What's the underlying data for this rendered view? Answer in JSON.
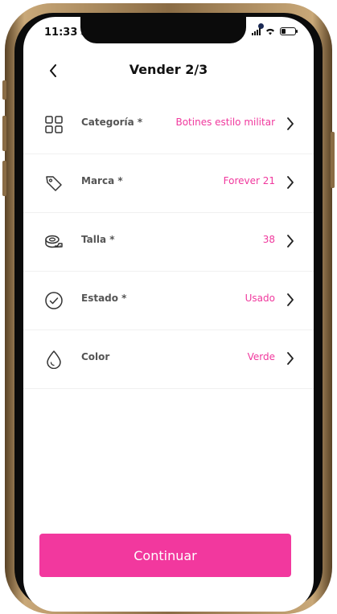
{
  "status_bar": {
    "time": "11:33",
    "location_glyph": "➶"
  },
  "header": {
    "title": "Vender 2/3",
    "back_icon": "chevron-left-icon"
  },
  "fields": [
    {
      "key": "categoria",
      "label": "Categoría *",
      "value": "Botines estilo militar",
      "icon": "grid-icon"
    },
    {
      "key": "marca",
      "label": "Marca *",
      "value": "Forever 21",
      "icon": "tag-icon"
    },
    {
      "key": "talla",
      "label": "Talla *",
      "value": "38",
      "icon": "tape-measure-icon"
    },
    {
      "key": "estado",
      "label": "Estado *",
      "value": "Usado",
      "icon": "check-circle-icon"
    },
    {
      "key": "color",
      "label": "Color",
      "value": "Verde",
      "icon": "drop-icon"
    }
  ],
  "cta": {
    "label": "Continuar"
  },
  "colors": {
    "accent": "#f2389e",
    "value_text": "#f0389d",
    "label_text": "#555555"
  }
}
